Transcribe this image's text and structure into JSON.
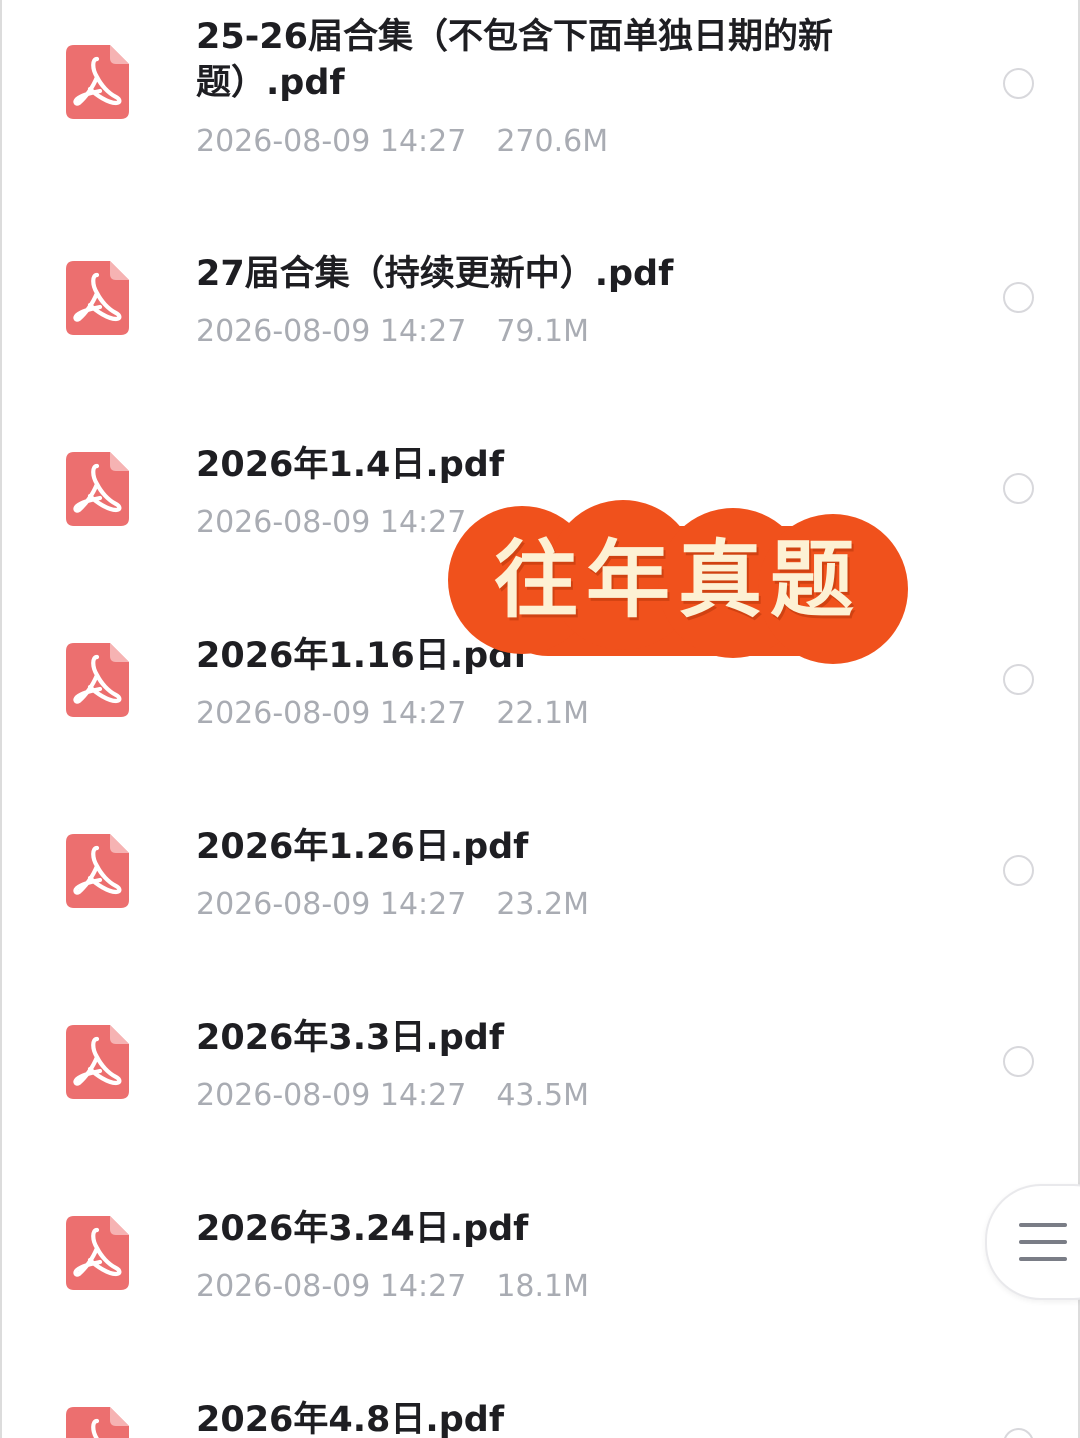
{
  "files": [
    {
      "name": "25-26届合集（不包含下面单独日期的新题）.pdf",
      "date": "2026-08-09 14:27",
      "size": "270.6M",
      "icon": "pdf-icon"
    },
    {
      "name": "27届合集（持续更新中）.pdf",
      "date": "2026-08-09 14:27",
      "size": "79.1M",
      "icon": "pdf-icon"
    },
    {
      "name": "2026年1.4日.pdf",
      "date": "2026-08-09 14:27",
      "size": "",
      "icon": "pdf-icon"
    },
    {
      "name": "2026年1.16日.pdf",
      "date": "2026-08-09 14:27",
      "size": "22.1M",
      "icon": "pdf-icon"
    },
    {
      "name": "2026年1.26日.pdf",
      "date": "2026-08-09 14:27",
      "size": "23.2M",
      "icon": "pdf-icon"
    },
    {
      "name": "2026年3.3日.pdf",
      "date": "2026-08-09 14:27",
      "size": "43.5M",
      "icon": "pdf-icon"
    },
    {
      "name": "2026年3.24日.pdf",
      "date": "2026-08-09 14:27",
      "size": "18.1M",
      "icon": "pdf-icon"
    },
    {
      "name": "2026年4.8日.pdf",
      "date": "",
      "size": "",
      "icon": "pdf-icon"
    }
  ],
  "overlay": {
    "text": "往年真题",
    "background_color": "#f0511c",
    "text_color": "#fdf1d4"
  },
  "menu_button": {
    "icon": "hamburger-menu-icon"
  },
  "colors": {
    "pdf_icon": "#ec6f6f",
    "file_name": "#1e1e22",
    "meta_text": "#a9acb3",
    "radio_border": "#d8d8dc"
  }
}
